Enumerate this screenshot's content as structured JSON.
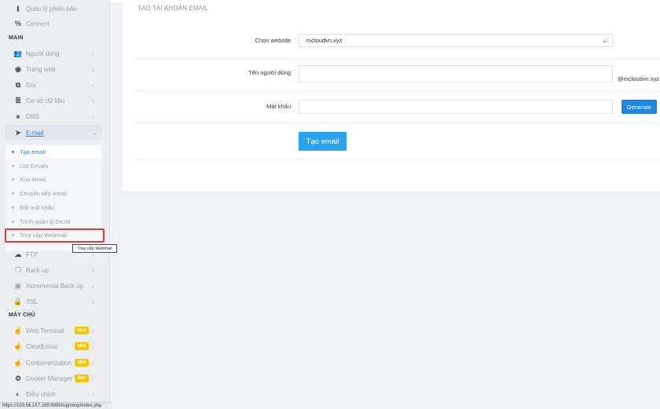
{
  "sidebar": {
    "top_items": [
      {
        "label": "Quản lý phiên bản",
        "icon": "info-icon"
      },
      {
        "label": "Connect",
        "icon": "link-icon"
      }
    ],
    "section_main": "MAIN",
    "main_items": [
      {
        "label": "Người dùng",
        "icon": "users-icon",
        "chevron": "›"
      },
      {
        "label": "Trang web",
        "icon": "globe-icon",
        "chevron": "›"
      },
      {
        "label": "Gói",
        "icon": "cubes-icon",
        "chevron": "›"
      },
      {
        "label": "Cơ sở dữ liệu",
        "icon": "database-icon",
        "chevron": "›"
      },
      {
        "label": "DNS",
        "icon": "sitemap-icon",
        "chevron": "›"
      },
      {
        "label": "E-mail",
        "icon": "paper-plane-icon",
        "chevron": "⌄"
      }
    ],
    "email_submenu": [
      {
        "label": "Tạo email",
        "active": true
      },
      {
        "label": "List Emails"
      },
      {
        "label": "Xóa email"
      },
      {
        "label": "Chuyển tiếp email"
      },
      {
        "label": "Đổi mật khẩu"
      },
      {
        "label": "Trình quản lý DKIM"
      },
      {
        "label": "Truy cập Webmail"
      }
    ],
    "after_items": [
      {
        "label": "FTP",
        "icon": "cloud-upload-icon",
        "chevron": "›"
      },
      {
        "label": "Back up",
        "icon": "copy-icon",
        "chevron": "›"
      },
      {
        "label": "Incremental Back up",
        "icon": "save-icon",
        "chevron": "›"
      },
      {
        "label": "SSL",
        "icon": "lock-icon",
        "chevron": "›"
      }
    ],
    "section_server": "MÁY CHỦ",
    "server_items": [
      {
        "label": "Web Terminal",
        "icon": "hand-pointer-icon",
        "badge": "Mới",
        "chevron": "›"
      },
      {
        "label": "CloudLinux",
        "icon": "hand-pointer-icon",
        "badge": "Mới",
        "chevron": "›"
      },
      {
        "label": "Containerization",
        "icon": "hand-pointer-icon",
        "badge": "Mới",
        "chevron": "›"
      },
      {
        "label": "Docker Manager",
        "icon": "cogs-icon",
        "badge": "Mới",
        "chevron": "›"
      },
      {
        "label": "Điều chỉnh",
        "icon": "adjust-icon",
        "chevron": "›"
      }
    ],
    "tooltip": "Truy cập Webmail"
  },
  "status_url": "https://103.56.157.189:8090/signloop/index.php",
  "main": {
    "title": "TẠO TÀI KHOẢN EMAIL",
    "website_label": "Chọn website",
    "website_value": "mcloudvn.xyz",
    "username_label": "Tên người dùng",
    "username_value": "",
    "domain_suffix": "@mcloudvn.xyz",
    "password_label": "Mật khẩu",
    "password_value": "",
    "generate_label": "Generate",
    "create_label": "Tạo email"
  },
  "colors": {
    "accent": "#1e88e5",
    "create_button": "#29a3ef",
    "badge": "#f7c600",
    "highlight": "#e53935"
  }
}
